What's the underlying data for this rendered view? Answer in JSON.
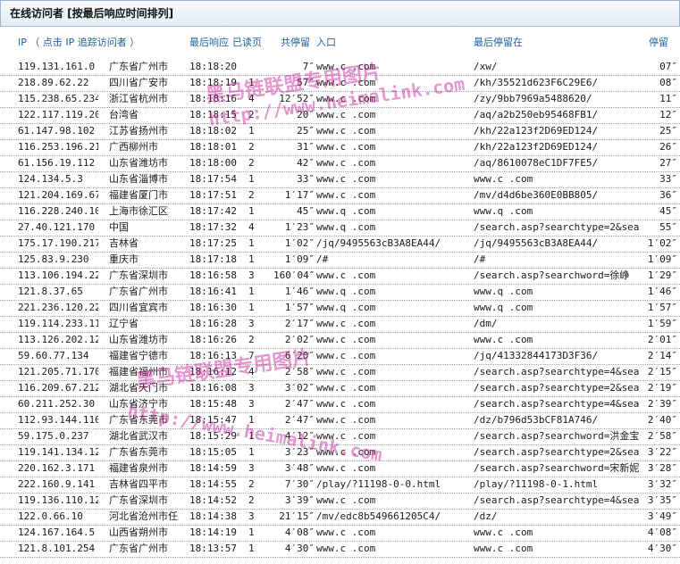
{
  "title": "在线访问者 [按最后响应时间排列]",
  "headers": {
    "ip": "IP （ 点击 IP 追踪访问者 ）",
    "last_response": "最后响应",
    "pages": "已读页",
    "stay": "共停留",
    "entry": "入口",
    "last_page": "最后停留在",
    "stay2": "停留"
  },
  "rows": [
    {
      "ip": "119.131.161.0",
      "region": "广东省广州市",
      "time": "18:18:20",
      "pages": "",
      "duration": "7″",
      "entry": "www.c    .com",
      "last": "/xw/",
      "stay": "07″"
    },
    {
      "ip": "218.89.62.22",
      "region": "四川省广安市",
      "time": "18:18:19",
      "pages": "1",
      "duration": "57″",
      "entry": "www.c    .com",
      "last": "/kh/35521d623F6C29E6/",
      "stay": "08″"
    },
    {
      "ip": "115.238.65.234",
      "region": "浙江省杭州市",
      "time": "18:18:16",
      "pages": "4",
      "duration": "12′52″",
      "entry": "www.c    .com",
      "last": "/zy/9bb7969a5488620/",
      "stay": "11″"
    },
    {
      "ip": "122.117.119.20",
      "region": "台湾省",
      "time": "18:18:15",
      "pages": "2",
      "duration": "20″",
      "entry": "www.c    .com",
      "last": "/aq/a2b250eb95468FB1/",
      "stay": "12″"
    },
    {
      "ip": "61.147.98.102",
      "region": "江苏省扬州市",
      "time": "18:18:02",
      "pages": "1",
      "duration": "25″",
      "entry": "www.c    .com",
      "last": "/kh/22a123f2D69ED124/",
      "stay": "25″"
    },
    {
      "ip": "116.253.196.216",
      "region": "广西柳州市",
      "time": "18:18:01",
      "pages": "2",
      "duration": "31″",
      "entry": "www.c    .com",
      "last": "/kh/22a123f2D69ED124/",
      "stay": "26″"
    },
    {
      "ip": "61.156.19.112",
      "region": "山东省潍坊市",
      "time": "18:18:00",
      "pages": "2",
      "duration": "42″",
      "entry": "www.c    .com",
      "last": "/aq/8610078eC1DF7FE5/",
      "stay": "27″"
    },
    {
      "ip": "124.134.5.3",
      "region": "山东省淄博市",
      "time": "18:17:54",
      "pages": "1",
      "duration": "33″",
      "entry": "www.c    .com",
      "last": "www.c    .com",
      "stay": "33″"
    },
    {
      "ip": "121.204.169.67",
      "region": "福建省厦门市",
      "time": "18:17:51",
      "pages": "2",
      "duration": "1′17″",
      "entry": "www.c    .com",
      "last": "/mv/d4d6be360E0BB805/",
      "stay": "36″"
    },
    {
      "ip": "116.228.240.106",
      "region": "上海市徐汇区",
      "time": "18:17:42",
      "pages": "1",
      "duration": "45″",
      "entry": "www.q    .com",
      "last": "www.q    .com",
      "stay": "45″"
    },
    {
      "ip": "27.40.121.170",
      "region": "中国",
      "time": "18:17:32",
      "pages": "4",
      "duration": "1′23″",
      "entry": "www.q    .com",
      "last": "/search.asp?searchtype=2&sea",
      "stay": "55″"
    },
    {
      "ip": "175.17.190.217",
      "region": "吉林省",
      "time": "18:17:25",
      "pages": "1",
      "duration": "1′02″",
      "entry": "/jq/9495563cB3A8EA44/",
      "last": "/jq/9495563cB3A8EA44/",
      "stay": "1′02″"
    },
    {
      "ip": "125.83.9.230",
      "region": "重庆市",
      "time": "18:17:18",
      "pages": "1",
      "duration": "1′09″",
      "entry": "/#",
      "last": "/#",
      "stay": "1′09″"
    },
    {
      "ip": "113.106.194.228",
      "region": "广东省深圳市",
      "time": "18:16:58",
      "pages": "3",
      "duration": "160′04″",
      "entry": "www.c    .com",
      "last": "/search.asp?searchword=徐峥",
      "stay": "1′29″"
    },
    {
      "ip": "121.8.37.65",
      "region": "广东省广州市",
      "time": "18:16:41",
      "pages": "1",
      "duration": "1′46″",
      "entry": "www.q    .com",
      "last": "www.q    .com",
      "stay": "1′46″"
    },
    {
      "ip": "221.236.120.226",
      "region": "四川省宜宾市",
      "time": "18:16:30",
      "pages": "1",
      "duration": "1′57″",
      "entry": "www.q    .com",
      "last": "www.q    .com",
      "stay": "1′57″"
    },
    {
      "ip": "119.114.233.112",
      "region": "辽宁省",
      "time": "18:16:28",
      "pages": "3",
      "duration": "2′17″",
      "entry": "www.c    .com",
      "last": "/dm/",
      "stay": "1′59″"
    },
    {
      "ip": "113.126.202.126",
      "region": "山东省潍坊市",
      "time": "18:16:26",
      "pages": "2",
      "duration": "2′02″",
      "entry": "www.c    .com",
      "last": "www.c    .com",
      "stay": "2′01″"
    },
    {
      "ip": "59.60.77.134",
      "region": "福建省宁德市",
      "time": "18:16:13",
      "pages": "7",
      "duration": "6′20″",
      "entry": "www.c    .com",
      "last": "/jq/41332844173D3F36/",
      "stay": "2′14″"
    },
    {
      "ip": "121.205.71.170",
      "region": "福建省福州市",
      "time": "18:16:12",
      "pages": "4",
      "duration": "2′58″",
      "entry": "www.c    .com",
      "last": "/search.asp?searchtype=4&sea",
      "stay": "2′15″"
    },
    {
      "ip": "116.209.67.212",
      "region": "湖北省天门市",
      "time": "18:16:08",
      "pages": "3",
      "duration": "3′02″",
      "entry": "www.c    .com",
      "last": "/search.asp?searchtype=2&sea",
      "stay": "2′19″"
    },
    {
      "ip": "60.211.252.30",
      "region": "山东省济宁市",
      "time": "18:15:48",
      "pages": "3",
      "duration": "2′47″",
      "entry": "www.c    .com",
      "last": "/search.asp?searchtype=4&sea",
      "stay": "2′39″"
    },
    {
      "ip": "112.93.144.110",
      "region": "广东省东莞市",
      "time": "18:15:47",
      "pages": "1",
      "duration": "2′47″",
      "entry": "www.c    .com",
      "last": "/dz/b796d53bCF81A746/",
      "stay": "2′40″"
    },
    {
      "ip": "59.175.0.237",
      "region": "湖北省武汉市",
      "time": "18:15:29",
      "pages": "1",
      "duration": "4′12″",
      "entry": "www.c    .com",
      "last": "/search.asp?searchword=洪金宝",
      "stay": "2′58″"
    },
    {
      "ip": "119.141.134.126",
      "region": "广东省东莞市",
      "time": "18:15:05",
      "pages": "1",
      "duration": "3′23″",
      "entry": "www.c    .com",
      "last": "/search.asp?searchtype=2&sea",
      "stay": "3′22″"
    },
    {
      "ip": "220.162.3.171",
      "region": "福建省泉州市",
      "time": "18:14:59",
      "pages": "3",
      "duration": "3′48″",
      "entry": "www.c    .com",
      "last": "/search.asp?searchword=宋新妮",
      "stay": "3′28″"
    },
    {
      "ip": "222.160.9.141",
      "region": "吉林省四平市",
      "time": "18:14:55",
      "pages": "2",
      "duration": "7′30″",
      "entry": "/play/?11198-0-0.html",
      "last": "/play/?11198-0-1.html",
      "stay": "3′32″"
    },
    {
      "ip": "119.136.110.121",
      "region": "广东省深圳市",
      "time": "18:14:52",
      "pages": "2",
      "duration": "3′39″",
      "entry": "www.c    .com",
      "last": "/search.asp?searchtype=4&sea",
      "stay": "3′35″"
    },
    {
      "ip": "122.0.66.10",
      "region": "河北省沧州市任",
      "time": "18:14:38",
      "pages": "3",
      "duration": "21′15″",
      "entry": "/mv/edc8b549661205C4/",
      "last": "/dz/",
      "stay": "3′49″"
    },
    {
      "ip": "124.167.164.5",
      "region": "山西省朔州市",
      "time": "18:14:19",
      "pages": "1",
      "duration": "4′08″",
      "entry": "www.c    .com",
      "last": "www.c    .com",
      "stay": "4′08″"
    },
    {
      "ip": "121.8.101.254",
      "region": "广东省广州市",
      "time": "18:13:57",
      "pages": "1",
      "duration": "4′30″",
      "entry": "www.c    .com",
      "last": "www.c    .com",
      "stay": "4′30″"
    }
  ],
  "watermarks": {
    "cn": "黑马链联盟专用图片",
    "url": "http://www.heimalink.com"
  },
  "colors": {
    "header_text": "#1f5f9f",
    "watermark": "#c21a94"
  }
}
